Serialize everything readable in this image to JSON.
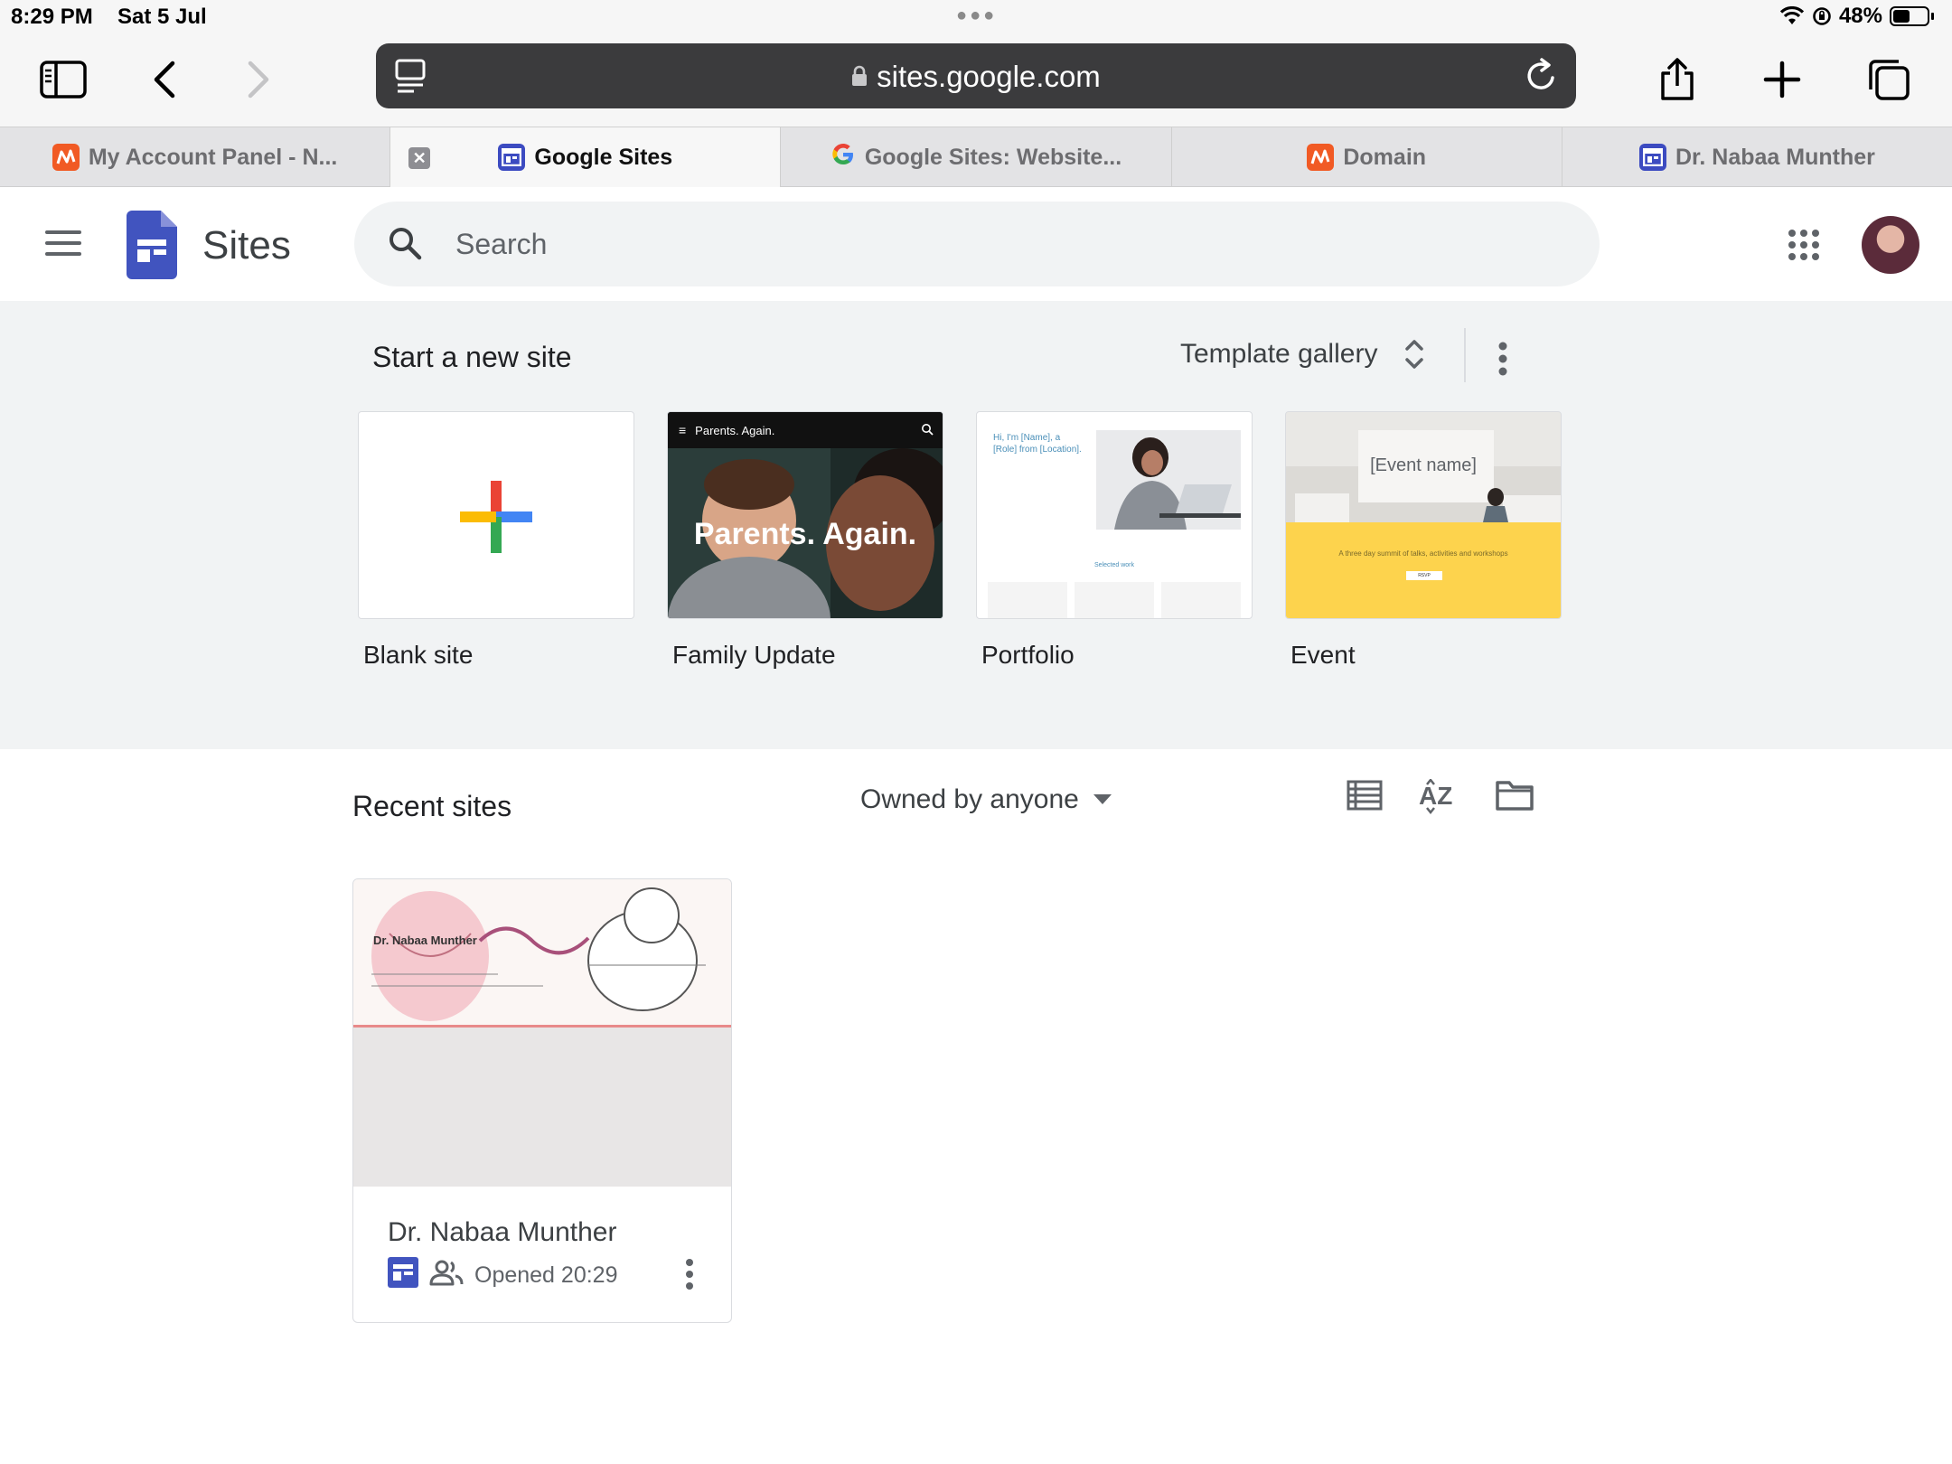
{
  "status_bar": {
    "time": "8:29 PM",
    "date": "Sat 5 Jul",
    "battery": "48%"
  },
  "browser": {
    "url": "sites.google.com",
    "tabs": [
      {
        "label": "My Account Panel - N...",
        "icon": "namecheap-icon"
      },
      {
        "label": "Google Sites",
        "icon": "google-sites-icon",
        "active": true
      },
      {
        "label": "Google Sites: Website...",
        "icon": "google-icon"
      },
      {
        "label": "Domain",
        "icon": "namecheap-icon"
      },
      {
        "label": "Dr. Nabaa Munther",
        "icon": "google-sites-icon"
      }
    ]
  },
  "header": {
    "app_name": "Sites",
    "search_placeholder": "Search"
  },
  "new_site": {
    "title": "Start a new site",
    "template_gallery": "Template gallery",
    "templates": [
      {
        "label": "Blank site"
      },
      {
        "label": "Family Update",
        "thumb_title": "Parents. Again.",
        "thumb_heading": "Parents. Again."
      },
      {
        "label": "Portfolio",
        "thumb_text": "Hi, I'm [Name], a [Role] from [Location].",
        "thumb_footer": "Selected work"
      },
      {
        "label": "Event",
        "thumb_heading": "[Event name]",
        "thumb_text": "A three day summit of talks, activities and workshops",
        "thumb_button": "RSVP"
      }
    ]
  },
  "recent": {
    "title": "Recent sites",
    "owner_filter": "Owned by anyone",
    "sites": [
      {
        "title": "Dr. Nabaa Munther",
        "thumb_heading": "Dr. Nabaa Munther",
        "opened": "Opened 20:29"
      }
    ]
  },
  "colors": {
    "sites_blue": "#4154bf",
    "google_red": "#ea4335",
    "google_blue": "#4285f4",
    "google_yellow": "#fbbc04",
    "google_green": "#34a853",
    "event_yellow": "#fdd34d"
  }
}
